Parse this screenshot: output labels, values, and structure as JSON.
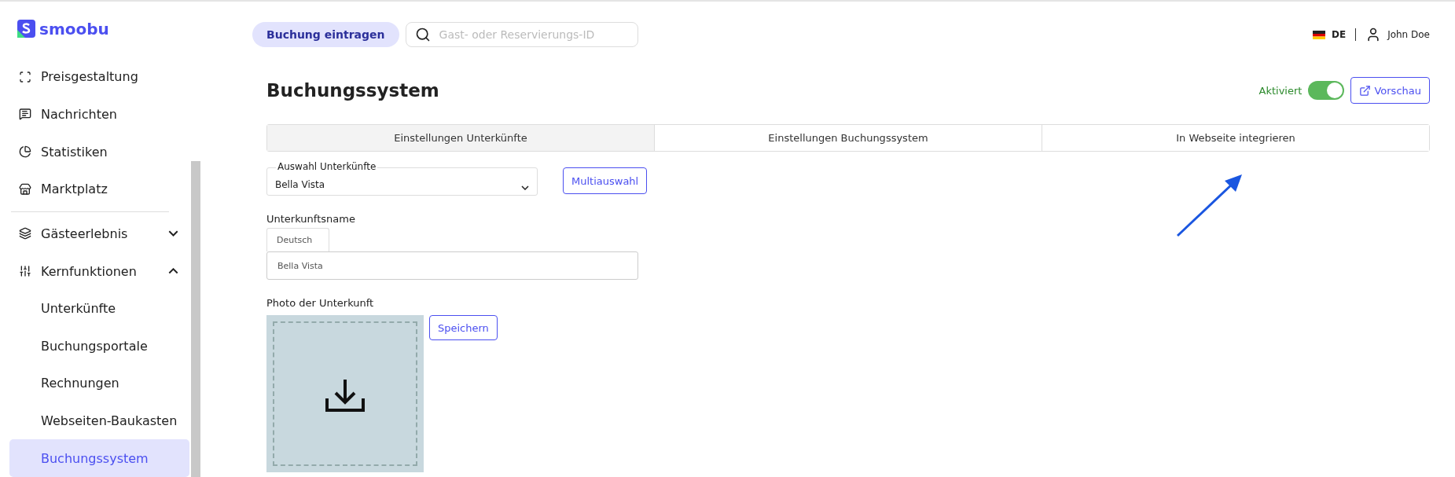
{
  "logo": {
    "text": "smoobu"
  },
  "sidebar": {
    "items": [
      {
        "label": "Preisgestaltung",
        "selected": false
      },
      {
        "label": "Nachrichten",
        "selected": false
      },
      {
        "label": "Statistiken",
        "selected": false
      },
      {
        "label": "Marktplatz",
        "selected": false
      }
    ],
    "groups": [
      {
        "label": "Gästeerlebnis",
        "expanded": false
      },
      {
        "label": "Kernfunktionen",
        "expanded": true,
        "children": [
          {
            "label": "Unterkünfte",
            "selected": false
          },
          {
            "label": "Buchungsportale",
            "selected": false
          },
          {
            "label": "Rechnungen",
            "selected": false
          },
          {
            "label": "Webseiten-Baukasten",
            "selected": false
          },
          {
            "label": "Buchungssystem",
            "selected": true
          }
        ]
      }
    ]
  },
  "topbar": {
    "add_button": "Buchung eintragen",
    "search": {
      "placeholder": "Gast- oder Reservierungs-ID"
    },
    "language": "DE",
    "user": "John Doe"
  },
  "page": {
    "title": "Buchungssystem",
    "status": {
      "label": "Aktiviert",
      "on": true
    },
    "preview_button": "Vorschau",
    "tabs": [
      {
        "label": "Einstellungen Unterkünfte",
        "selected": true
      },
      {
        "label": "Einstellungen Buchungssystem",
        "selected": false
      },
      {
        "label": "In Webseite integrieren",
        "selected": false
      }
    ],
    "property_select": {
      "label": "Auswahl Unterkünfte",
      "value": "Bella Vista"
    },
    "multi_button": "Multiauswahl",
    "name_field": {
      "label": "Unterkunftsname",
      "language_tab": "Deutsch",
      "value": "Bella Vista"
    },
    "photo": {
      "label": "Photo der Unterkunft",
      "save_button": "Speichern"
    }
  }
}
